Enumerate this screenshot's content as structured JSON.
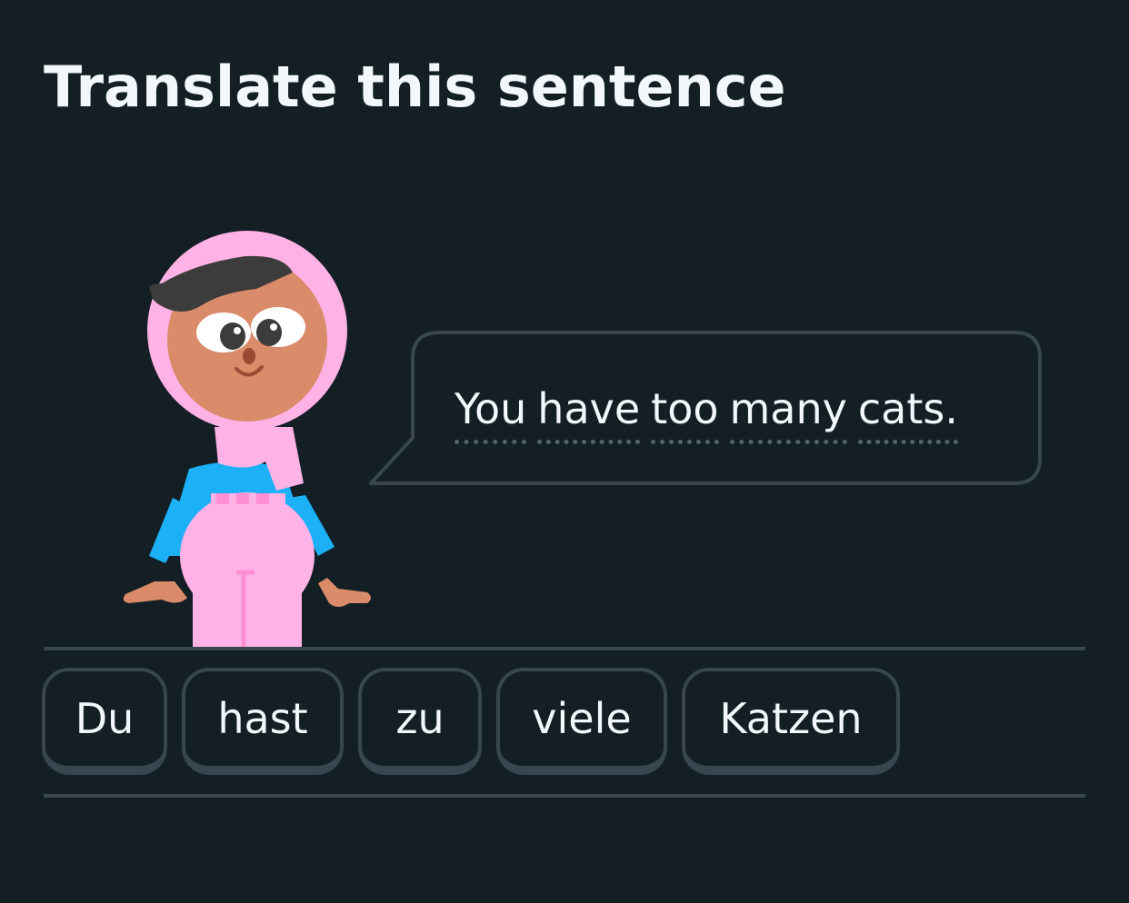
{
  "prompt": {
    "title": "Translate this sentence"
  },
  "speech": {
    "words": [
      "You",
      "have",
      "too",
      "many",
      "cats."
    ]
  },
  "word_bank": {
    "tiles": [
      "Du",
      "hast",
      "zu",
      "viele",
      "Katzen"
    ]
  },
  "colors": {
    "background": "#131f24",
    "text": "#f1f7fb",
    "border": "#37464f",
    "hijab": "#ffb2e6",
    "shirt": "#1cb0f6",
    "skin": "#d98b6a",
    "hair": "#3c3c3c"
  }
}
